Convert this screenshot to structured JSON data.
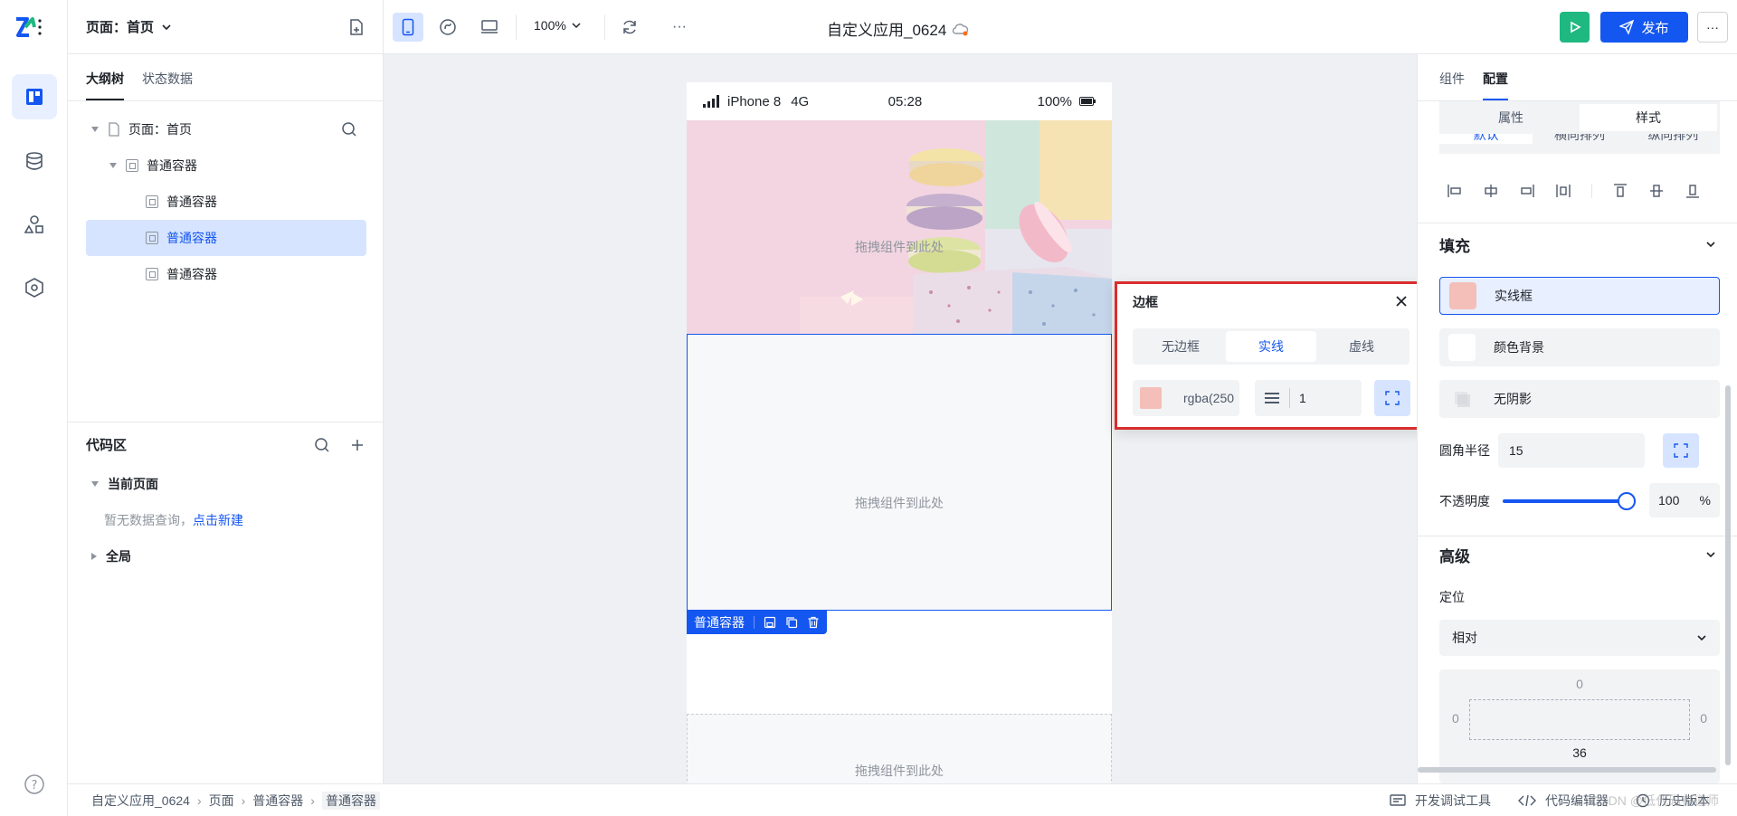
{
  "rail": {
    "items": [
      {
        "name": "outline-panel-icon",
        "active": true
      },
      {
        "name": "database-icon",
        "active": false
      },
      {
        "name": "components-icon",
        "active": false
      },
      {
        "name": "settings-hex-icon",
        "active": false
      }
    ]
  },
  "left_panel": {
    "page_selector": "页面：首页",
    "tabs": [
      "大纲树",
      "状态数据"
    ],
    "active_tab": 0,
    "tree": [
      {
        "label": "页面：首页",
        "level": 0,
        "icon": "page-icon",
        "expanded": true,
        "selected": false
      },
      {
        "label": "普通容器",
        "level": 1,
        "icon": "container-icon",
        "expanded": true,
        "selected": false
      },
      {
        "label": "普通容器",
        "level": 2,
        "icon": "container-icon",
        "selected": false
      },
      {
        "label": "普通容器",
        "level": 2,
        "icon": "container-icon",
        "selected": true
      },
      {
        "label": "普通容器",
        "level": 2,
        "icon": "container-icon",
        "selected": false
      }
    ],
    "code_area": {
      "title": "代码区",
      "current_page": "当前页面",
      "empty_text": "暂无数据查询，",
      "create_link": "点击新建",
      "global": "全局"
    }
  },
  "toolbar": {
    "zoom": "100%",
    "app_title": "自定义应用_0624",
    "publish_label": "发布",
    "more_label": "···"
  },
  "canvas": {
    "status_bar": {
      "device": "iPhone 8",
      "network": "4G",
      "time": "05:28",
      "battery": "100%"
    },
    "drop_hint": "拖拽组件到此处",
    "selected_tag": "普通容器"
  },
  "border_popup": {
    "title": "边框",
    "styles": [
      "无边框",
      "实线",
      "虚线"
    ],
    "active_style": 1,
    "color_value": "rgba(250",
    "color_swatch": "#f4bfb8",
    "width_value": "1"
  },
  "right_panel": {
    "tabs": [
      "组件",
      "配置"
    ],
    "active_tab": 1,
    "subtabs": [
      "属性",
      "样式"
    ],
    "active_subtab": 1,
    "layout_tabs": [
      "默认",
      "横向排列",
      "纵向排列"
    ],
    "fill": {
      "title": "填充",
      "options": [
        {
          "label": "实线框",
          "swatch": "#f4bfb8",
          "active": true
        },
        {
          "label": "颜色背景",
          "swatch": "#ffffff",
          "active": false
        },
        {
          "label": "无阴影",
          "swatch": "#e5e6eb",
          "active": false
        }
      ],
      "radius_label": "圆角半径",
      "radius_value": "15",
      "opacity_label": "不透明度",
      "opacity_value": "100",
      "opacity_unit": "%",
      "opacity_fraction": 1.0
    },
    "advanced": {
      "title": "高级",
      "position_label": "定位",
      "position_value": "相对",
      "box_top": "0",
      "box_left": "0",
      "box_right": "0",
      "box_bottom": "36"
    }
  },
  "bottom_bar": {
    "breadcrumb": [
      "自定义应用_0624",
      "页面",
      "普通容器",
      "普通容器"
    ],
    "dev_tools": "开发调试工具",
    "code_editor": "代码编辑器",
    "history": "历史版本",
    "watermark": "CSDN @低代码布道师"
  },
  "colors": {
    "primary": "#1456f0",
    "publish_bg": "#1456f0",
    "run_bg": "#1fb881",
    "highlight_border": "#d92d2d"
  }
}
